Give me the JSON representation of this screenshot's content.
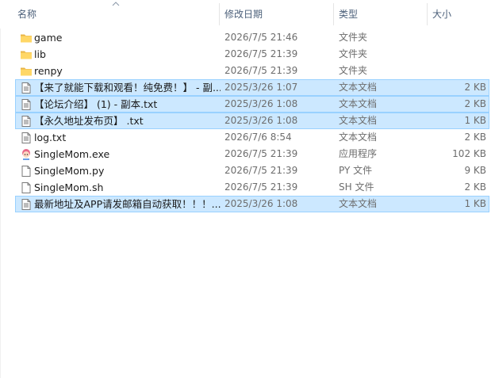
{
  "columns": {
    "name": "名称",
    "date": "修改日期",
    "type": "类型",
    "size": "大小"
  },
  "files": [
    {
      "name": "game",
      "date": "2026/7/5 21:46",
      "type": "文件夹",
      "size": "",
      "icon": "folder-icon",
      "selected": false
    },
    {
      "name": "lib",
      "date": "2026/7/5 21:39",
      "type": "文件夹",
      "size": "",
      "icon": "folder-icon",
      "selected": false
    },
    {
      "name": "renpy",
      "date": "2026/7/5 21:39",
      "type": "文件夹",
      "size": "",
      "icon": "folder-icon",
      "selected": false
    },
    {
      "name": "【来了就能下载和观看！纯免费！】 - 副...",
      "date": "2025/3/26 1:07",
      "type": "文本文档",
      "size": "2 KB",
      "icon": "text-file-icon",
      "selected": true
    },
    {
      "name": "【论坛介绍】 (1) - 副本.txt",
      "date": "2025/3/26 1:08",
      "type": "文本文档",
      "size": "2 KB",
      "icon": "text-file-icon",
      "selected": true
    },
    {
      "name": "【永久地址发布页】 .txt",
      "date": "2025/3/26 1:08",
      "type": "文本文档",
      "size": "1 KB",
      "icon": "text-file-icon",
      "selected": true
    },
    {
      "name": "log.txt",
      "date": "2026/7/6 8:54",
      "type": "文本文档",
      "size": "2 KB",
      "icon": "text-file-icon",
      "selected": false
    },
    {
      "name": "SingleMom.exe",
      "date": "2026/7/5 21:39",
      "type": "应用程序",
      "size": "102 KB",
      "icon": "app-exe-icon",
      "selected": false
    },
    {
      "name": "SingleMom.py",
      "date": "2026/7/5 21:39",
      "type": "PY 文件",
      "size": "9 KB",
      "icon": "blank-file-icon",
      "selected": false
    },
    {
      "name": "SingleMom.sh",
      "date": "2026/7/5 21:39",
      "type": "SH 文件",
      "size": "2 KB",
      "icon": "blank-file-icon",
      "selected": false
    },
    {
      "name": "最新地址及APP请发邮箱自动获取！！！...",
      "date": "2025/3/26 1:08",
      "type": "文本文档",
      "size": "1 KB",
      "icon": "text-file-icon",
      "selected": true
    }
  ]
}
